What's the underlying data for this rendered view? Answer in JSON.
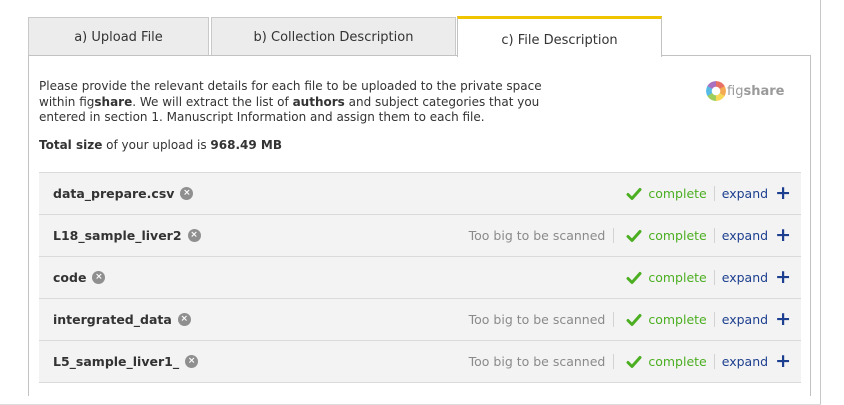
{
  "tabs": [
    {
      "label": "a) Upload File",
      "active": false
    },
    {
      "label": "b) Collection Description",
      "active": false
    },
    {
      "label": "c) File Description",
      "active": true
    }
  ],
  "intro": {
    "part1": "Please provide the relevant details for each file to be uploaded to the private space within fig",
    "part2": "share",
    "part3": ". We will extract the list of ",
    "part4": "authors",
    "part5": " and subject categories that you entered in section 1. Manuscript Information and assign them to each file."
  },
  "total": {
    "label": "Total size",
    "mid": " of your upload is ",
    "value": "968.49 MB"
  },
  "logo": {
    "prefix": "fig",
    "suffix": "share"
  },
  "files": [
    {
      "name": "data_prepare.csv",
      "note": "",
      "status": "complete",
      "action": "expand"
    },
    {
      "name": "L18_sample_liver2",
      "note": "Too big to be scanned",
      "status": "complete",
      "action": "expand"
    },
    {
      "name": "code",
      "note": "",
      "status": "complete",
      "action": "expand"
    },
    {
      "name": "intergrated_data",
      "note": "Too big to be scanned",
      "status": "complete",
      "action": "expand"
    },
    {
      "name": "L5_sample_liver1_",
      "note": "Too big to be scanned",
      "status": "complete",
      "action": "expand"
    }
  ],
  "colors": {
    "accent_tab": "#f1c400",
    "status_green": "#4caf22",
    "link_blue": "#1d3f8f"
  },
  "icons": {
    "remove": "remove-circle-icon",
    "check": "check-icon",
    "plus": "plus-icon"
  }
}
